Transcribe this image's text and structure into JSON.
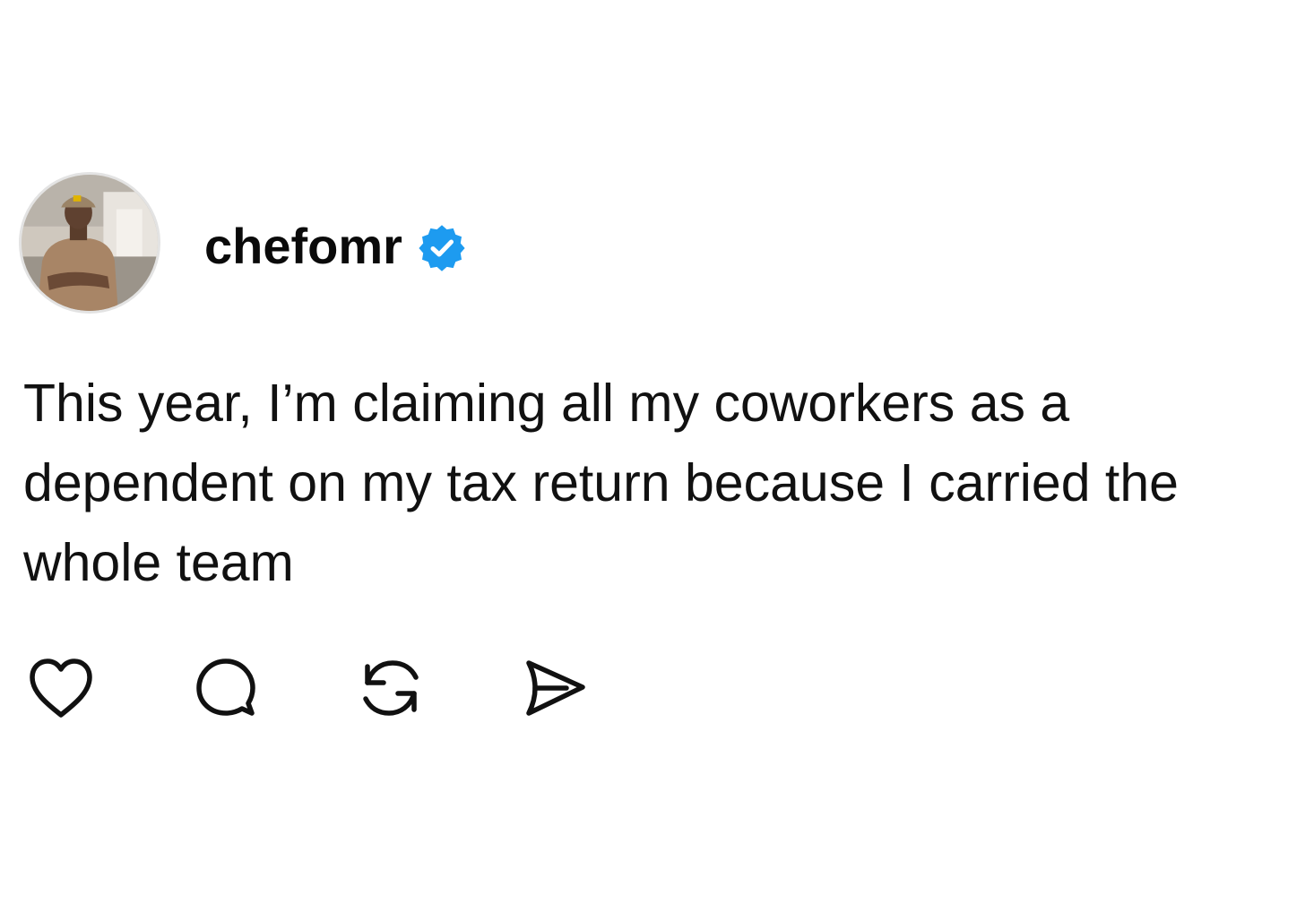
{
  "post": {
    "author": {
      "username": "chefomr",
      "verified": true,
      "verified_color": "#1d9bf0",
      "avatar_icon": "profile-photo"
    },
    "text": "This year, I’m claiming all my coworkers as a dependent on my tax return because I carried the whole team",
    "actions": [
      {
        "name": "like",
        "icon": "heart-icon"
      },
      {
        "name": "comment",
        "icon": "speech-bubble-icon"
      },
      {
        "name": "repost",
        "icon": "repost-icon"
      },
      {
        "name": "share",
        "icon": "paper-plane-icon"
      }
    ]
  }
}
